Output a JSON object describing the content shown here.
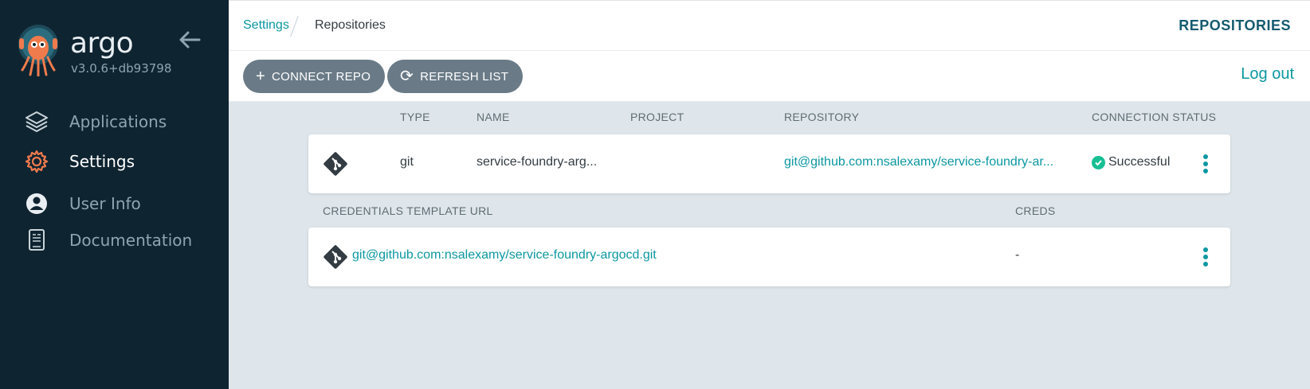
{
  "sidebar": {
    "brand": "argo",
    "version": "v3.0.6+db93798",
    "items": [
      {
        "label": "Applications",
        "icon": "layers-icon"
      },
      {
        "label": "Settings",
        "icon": "gear-icon"
      },
      {
        "label": "User Info",
        "icon": "user-circle-icon"
      },
      {
        "label": "Documentation",
        "icon": "book-icon"
      }
    ]
  },
  "header": {
    "breadcrumb_parent": "Settings",
    "breadcrumb_current": "Repositories",
    "title": "REPOSITORIES"
  },
  "toolbar": {
    "connect_label": "CONNECT REPO",
    "refresh_label": "REFRESH LIST",
    "logout_label": "Log out"
  },
  "repos_table": {
    "columns": [
      "TYPE",
      "NAME",
      "PROJECT",
      "REPOSITORY",
      "CONNECTION STATUS"
    ],
    "rows": [
      {
        "type": "git",
        "name": "service-foundry-arg...",
        "project": "",
        "repository": "git@github.com:nsalexamy/service-foundry-ar...",
        "status": "Successful"
      }
    ]
  },
  "creds_table": {
    "columns": [
      "CREDENTIALS TEMPLATE URL",
      "CREDS"
    ],
    "rows": [
      {
        "url": "git@github.com:nsalexamy/service-foundry-argocd.git",
        "creds": "-"
      }
    ]
  },
  "colors": {
    "sidebar_bg": "#0f2431",
    "accent": "#0c97a0",
    "button_bg": "#6a7b87",
    "content_bg": "#dee6eb",
    "success": "#18be94",
    "argo_orange": "#ef7b4d"
  }
}
